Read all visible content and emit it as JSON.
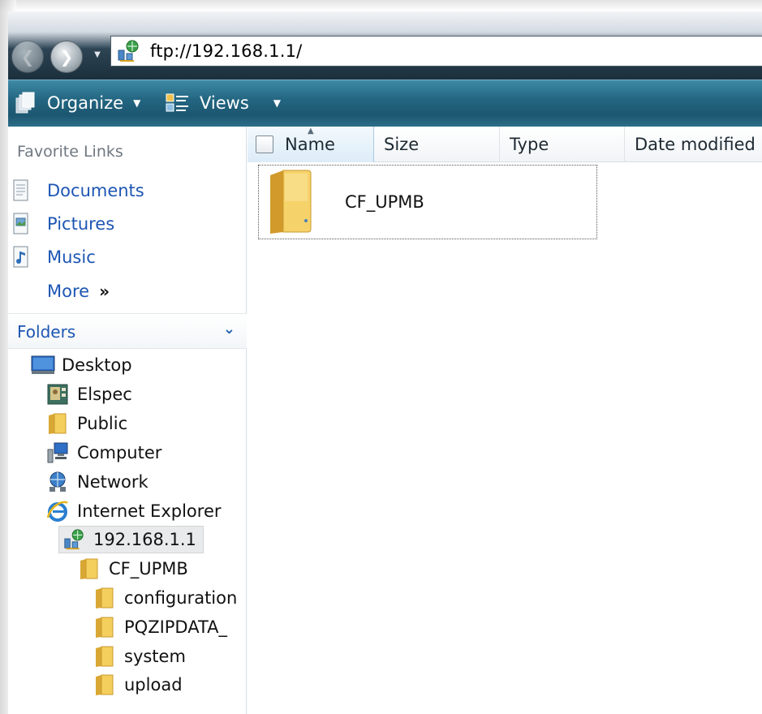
{
  "address": {
    "url": "ftp://192.168.1.1/"
  },
  "toolbar": {
    "organize_label": "Organize",
    "views_label": "Views"
  },
  "favorites": {
    "header": "Favorite Links",
    "items": [
      {
        "label": "Documents",
        "icon": "documents-icon"
      },
      {
        "label": "Pictures",
        "icon": "pictures-icon"
      },
      {
        "label": "Music",
        "icon": "music-icon"
      }
    ],
    "more_label": "More",
    "more_chevron": "»"
  },
  "folders": {
    "label": "Folders",
    "tree": [
      {
        "label": "Desktop",
        "icon": "desktop-icon"
      },
      {
        "label": "Elspec",
        "icon": "user-folder-icon"
      },
      {
        "label": "Public",
        "icon": "folder-icon"
      },
      {
        "label": "Computer",
        "icon": "computer-icon"
      },
      {
        "label": "Network",
        "icon": "network-icon"
      },
      {
        "label": "Internet Explorer",
        "icon": "internet-explorer-icon"
      },
      {
        "label": "192.168.1.1",
        "icon": "ftp-site-icon",
        "selected": true
      },
      {
        "label": "CF_UPMB",
        "icon": "folder-icon"
      },
      {
        "label": "configuration",
        "icon": "folder-icon"
      },
      {
        "label": "PQZIPDATA_",
        "icon": "folder-icon"
      },
      {
        "label": "system",
        "icon": "folder-icon"
      },
      {
        "label": "upload",
        "icon": "folder-icon"
      }
    ]
  },
  "columns": {
    "name": "Name",
    "size": "Size",
    "type": "Type",
    "date_modified": "Date modified"
  },
  "files": [
    {
      "name": "CF_UPMB",
      "icon": "large-folder-icon"
    }
  ],
  "colors": {
    "link_blue": "#1d56b3",
    "command_bar": "#246782",
    "folder_yellow": "#f2c84b"
  }
}
